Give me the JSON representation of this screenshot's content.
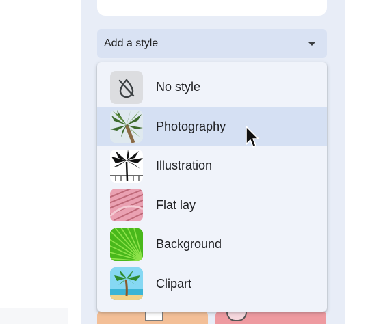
{
  "style_dropdown": {
    "label": "Add a style"
  },
  "menu": {
    "items": [
      {
        "label": "No style",
        "icon": "no-style-icon",
        "selected": false
      },
      {
        "label": "Photography",
        "icon": "photography-thumbnail",
        "selected": true
      },
      {
        "label": "Illustration",
        "icon": "illustration-thumbnail",
        "selected": false
      },
      {
        "label": "Flat lay",
        "icon": "flat-lay-thumbnail",
        "selected": false
      },
      {
        "label": "Background",
        "icon": "background-thumbnail",
        "selected": false
      },
      {
        "label": "Clipart",
        "icon": "clipart-thumbnail",
        "selected": false
      }
    ]
  },
  "colors": {
    "panel_bg": "#e8edf7",
    "dropdown_bg": "#d9e2f3",
    "menu_bg": "#f0f3fa",
    "highlight": "#d5e0f3"
  }
}
